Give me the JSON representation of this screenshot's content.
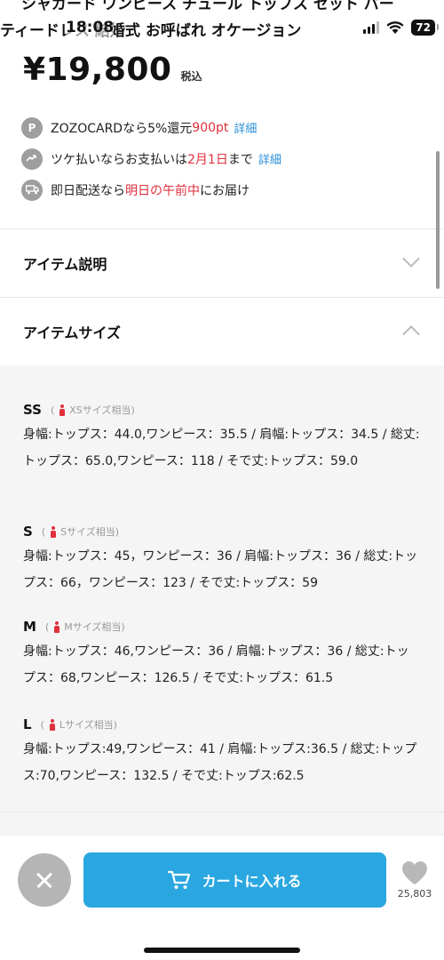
{
  "header": {
    "title_line1": "シャガード ワンピース チュール トップス セット パー",
    "title_line2": "ティードレス 結婚式 お呼ばれ オケージョン"
  },
  "status_bar": {
    "time": "18:08",
    "battery": "72"
  },
  "price": {
    "amount": "¥19,800",
    "tax_label": "税込"
  },
  "info": {
    "card": {
      "icon": "P",
      "prefix": "ZOZOCARDなら5%還元 ",
      "highlight": "900pt",
      "link": "詳細"
    },
    "tsuke": {
      "prefix": "ツケ払いならお支払いは",
      "highlight": "2月1日",
      "suffix": "まで",
      "link": "詳細"
    },
    "delivery": {
      "prefix": "即日配送なら",
      "highlight": "明日の午前中",
      "suffix": "にお届け"
    }
  },
  "sections": {
    "description": "アイテム説明",
    "size": "アイテムサイズ"
  },
  "sizes": [
    {
      "label": "SS",
      "equiv": "XSサイズ相当",
      "text": "身幅:トップス：44.0,ワンピース：35.5 / 肩幅:トップス：34.5 / 総丈:トップス：65.0,ワンピース：118 / そで丈:トップス：59.0"
    },
    {
      "label": "S",
      "equiv": "Sサイズ相当",
      "text": "身幅:トップス：45，ワンピース：36 / 肩幅:トップス：36 / 総丈:トップス：66，ワンピース：123 / そで丈:トップス：59"
    },
    {
      "label": "M",
      "equiv": "Mサイズ相当",
      "text": "身幅:トップス：46,ワンピース：36 / 肩幅:トップス：36 / 総丈:トップス：68,ワンピース：126.5 / そで丈:トップス：61.5"
    },
    {
      "label": "L",
      "equiv": "Lサイズ相当",
      "text": "身幅:トップス:49,ワンピース：41 / 肩幅:トップス:36.5 / 総丈:トップス:70,ワンピース：132.5 / そで丈:トップス:62.5"
    }
  ],
  "bottom": {
    "cart_label": "カートに入れる",
    "fav_count": "25,803"
  },
  "colors": {
    "accent": "#2aa7e0",
    "highlight": "#e0303c",
    "link": "#2a8ed8"
  }
}
